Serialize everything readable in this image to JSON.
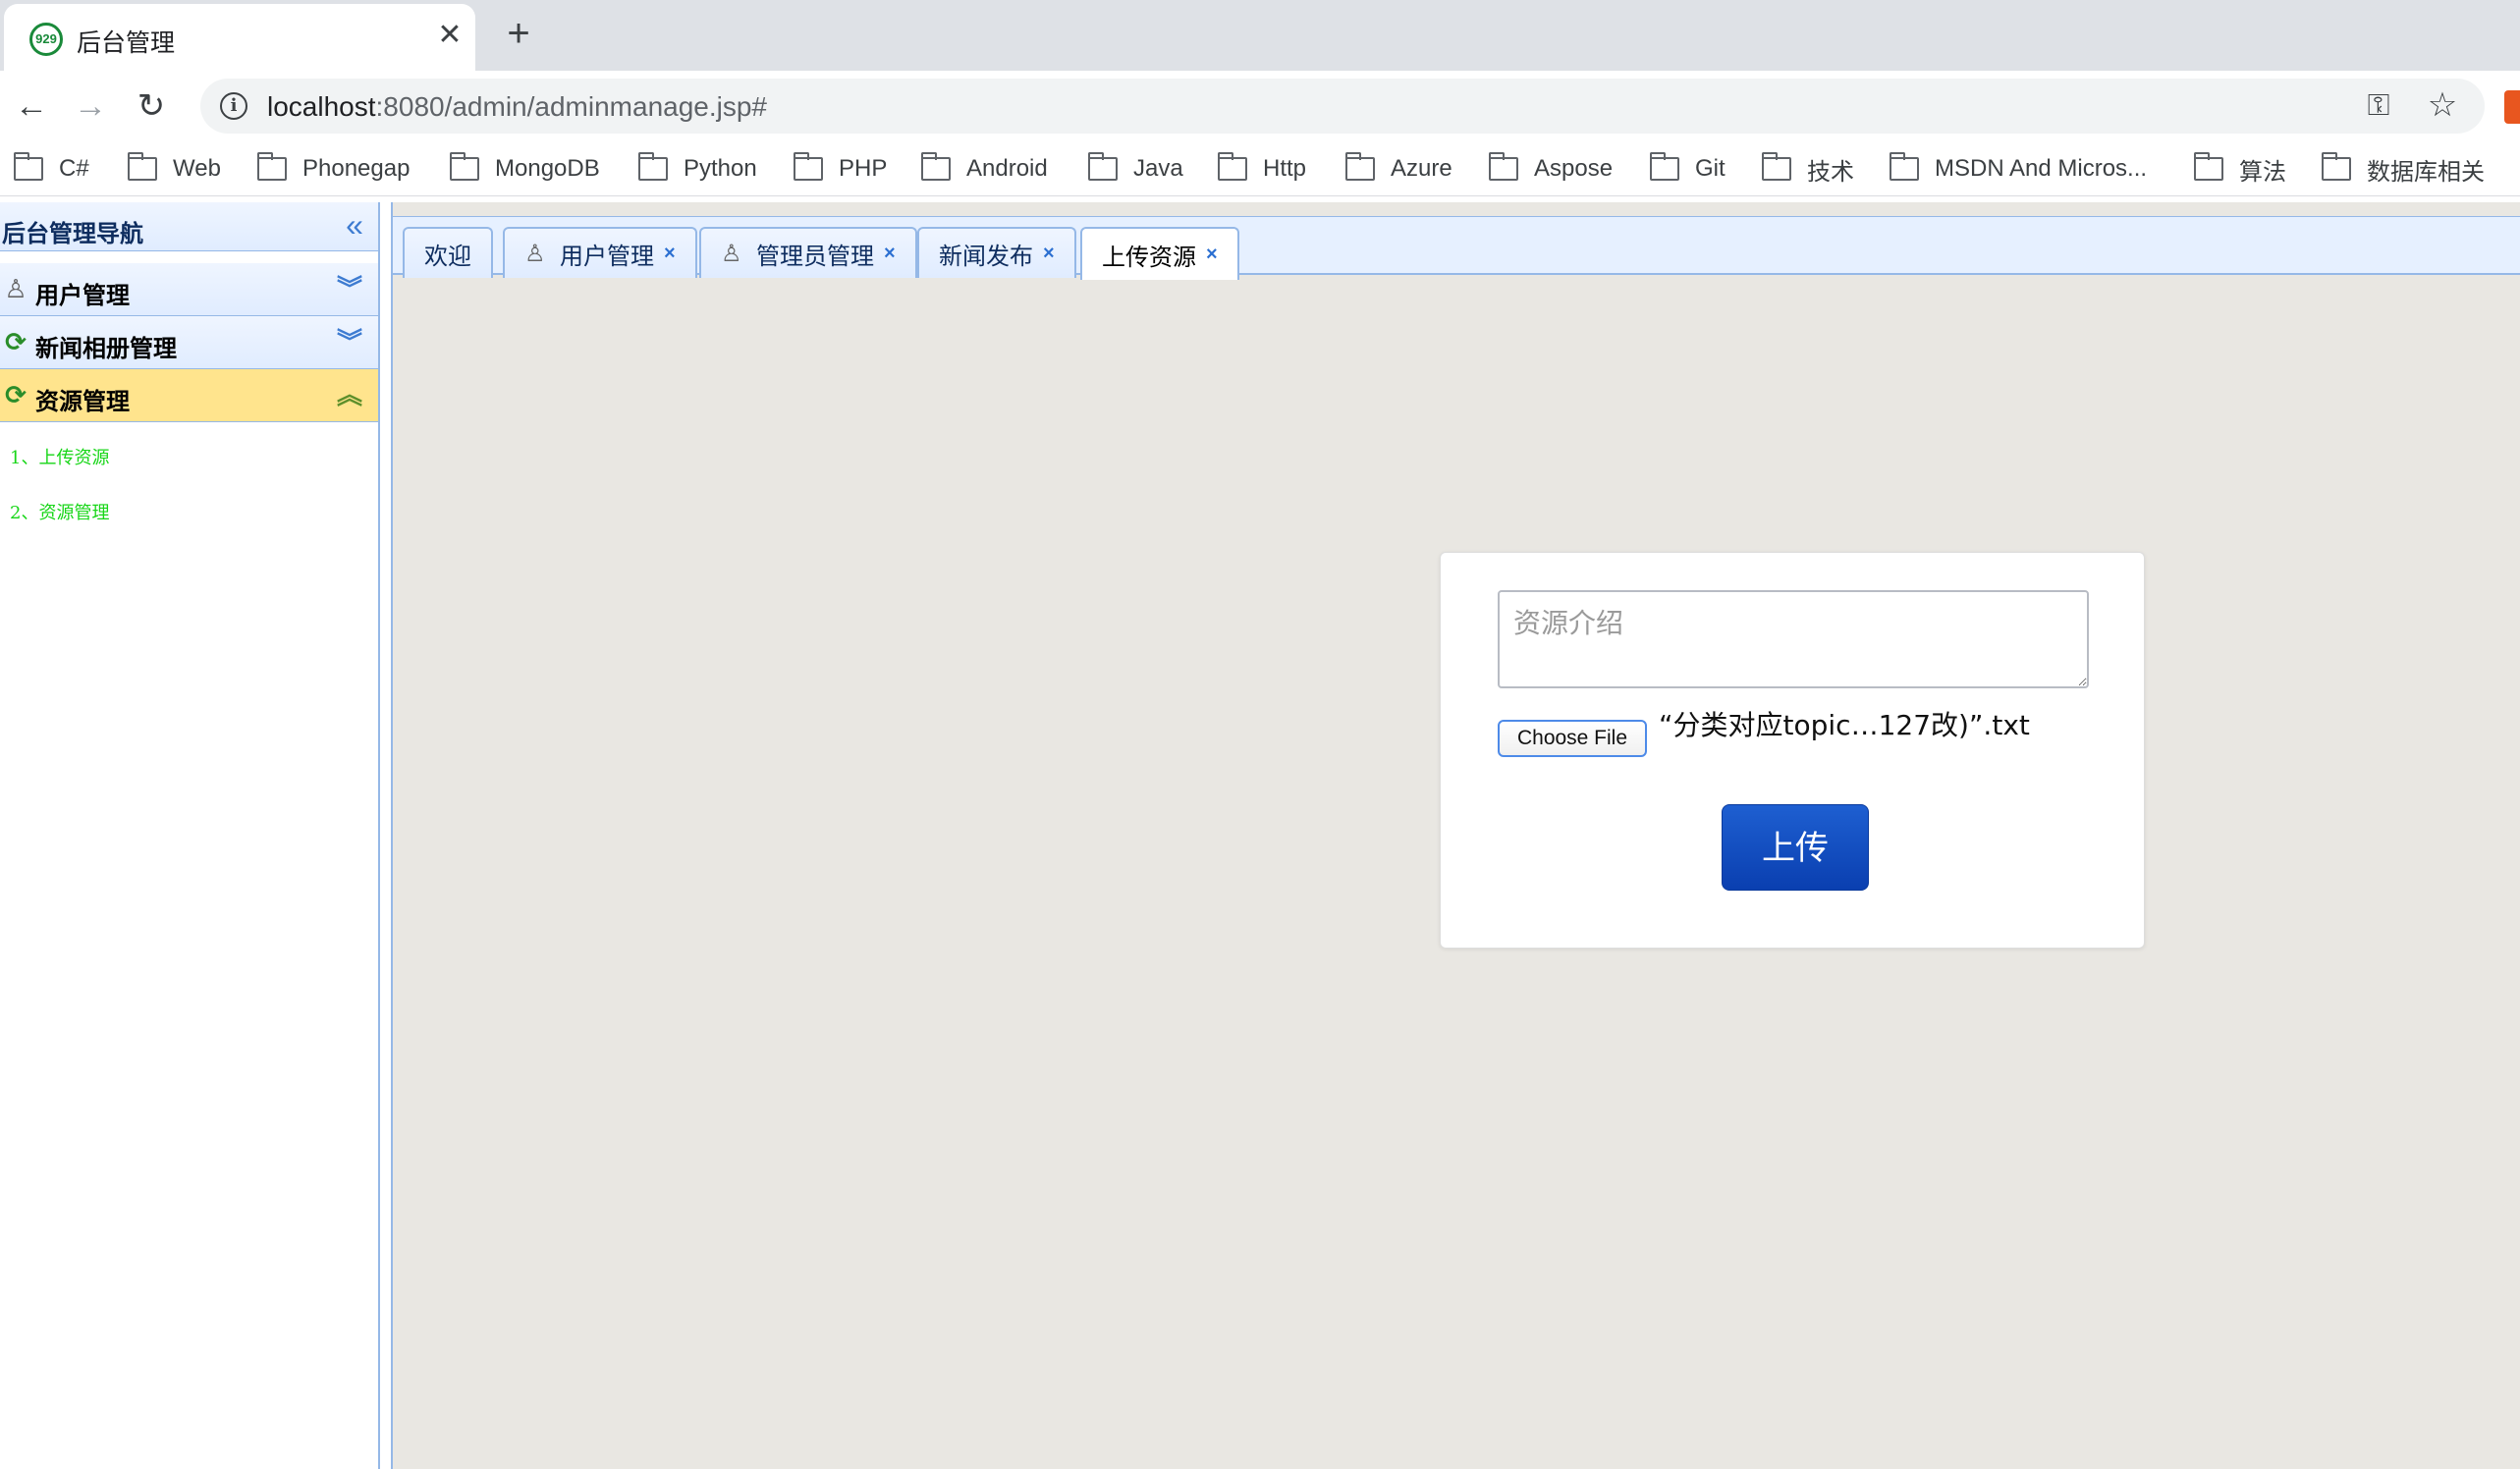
{
  "browser": {
    "tab_title": "后台管理",
    "favicon_text": "929",
    "close_glyph": "✕",
    "new_tab_glyph": "+",
    "url_host": "localhost",
    "url_rest": ":8080/admin/adminmanage.jsp#"
  },
  "bookmarks": [
    "C#",
    "Web",
    "Phonegap",
    "MongoDB",
    "Python",
    "PHP",
    "Android",
    "Java",
    "Http",
    "Azure",
    "Aspose",
    "Git",
    "技术",
    "MSDN And Micros...",
    "算法",
    "数据库相关"
  ],
  "leftnav": {
    "title": "后台管理导航",
    "panels": [
      {
        "label": "用户管理",
        "icon": "user-icon",
        "expanded": false
      },
      {
        "label": "新闻相册管理",
        "icon": "refresh-icon",
        "expanded": false
      },
      {
        "label": "资源管理",
        "icon": "refresh-icon",
        "expanded": true
      }
    ],
    "sub_items": [
      "1、上传资源",
      "2、资源管理"
    ]
  },
  "tabs": [
    {
      "label": "欢迎",
      "closable": false,
      "icon": ""
    },
    {
      "label": "用户管理",
      "closable": true,
      "icon": "user-icon"
    },
    {
      "label": "管理员管理",
      "closable": true,
      "icon": "user-icon"
    },
    {
      "label": "新闻发布",
      "closable": true,
      "icon": ""
    },
    {
      "label": "上传资源",
      "closable": true,
      "icon": "",
      "selected": true
    }
  ],
  "upload": {
    "description_placeholder": "资源介绍",
    "description_value": "",
    "choose_file_label": "Choose File",
    "file_name": "“分类对应topic…127改)”.txt",
    "submit_label": "上传"
  },
  "colors": {
    "accent_blue": "#95b8e7",
    "active_panel": "#ffe48d",
    "sub_item_green": "#17d617",
    "upload_button": "#0a3fb0"
  }
}
